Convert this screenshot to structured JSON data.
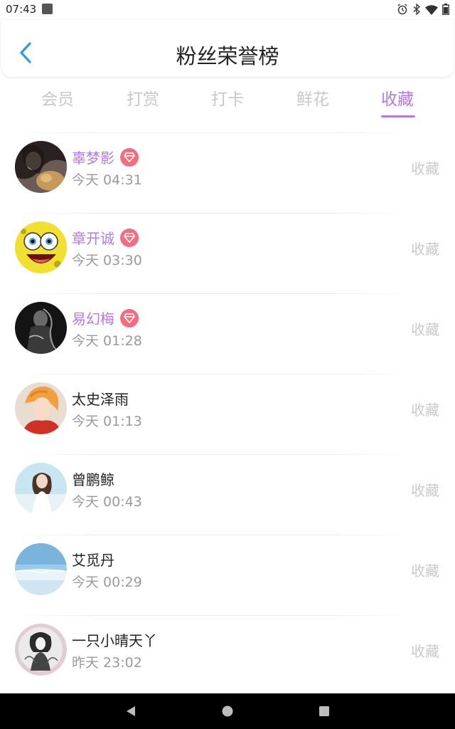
{
  "status_bar": {
    "time": "07:43",
    "icons": [
      "notification-app-icon",
      "alarm-icon",
      "bluetooth-icon",
      "wifi-icon",
      "battery-icon"
    ]
  },
  "header": {
    "title": "粉丝荣誉榜",
    "back_icon": "chevron-left-icon",
    "accent_color": "#2f9ae8"
  },
  "tabs": [
    {
      "label": "会员",
      "active": false
    },
    {
      "label": "打赏",
      "active": false
    },
    {
      "label": "打卡",
      "active": false
    },
    {
      "label": "鲜花",
      "active": false
    },
    {
      "label": "收藏",
      "active": true
    }
  ],
  "theme": {
    "active_color": "#b57ae0",
    "badge_color": "#f26d7d",
    "inactive_color": "#c8c8c8"
  },
  "fans": [
    {
      "name": "辜梦影",
      "time": "今天 04:31",
      "action": "收藏",
      "vip": true,
      "avatar": "avatar-dark-hair-with-cat"
    },
    {
      "name": "章开诚",
      "time": "今天 03:30",
      "action": "收藏",
      "vip": true,
      "avatar": "avatar-yellow-cartoon"
    },
    {
      "name": "易幻梅",
      "time": "今天 01:28",
      "action": "收藏",
      "vip": true,
      "avatar": "avatar-black-white-portrait"
    },
    {
      "name": "太史泽雨",
      "time": "今天 01:13",
      "action": "收藏",
      "vip": false,
      "avatar": "avatar-orange-hair-anime"
    },
    {
      "name": "曾鹏鲸",
      "time": "今天 00:43",
      "action": "收藏",
      "vip": false,
      "avatar": "avatar-beach-girl"
    },
    {
      "name": "艾觅丹",
      "time": "今天 00:29",
      "action": "收藏",
      "vip": false,
      "avatar": "avatar-blue-sky"
    },
    {
      "name": "一只小晴天丫",
      "time": "昨天 23:02",
      "action": "收藏",
      "vip": false,
      "avatar": "avatar-sketch-girl"
    }
  ],
  "nav_bar": {
    "buttons": [
      "back-triangle-icon",
      "home-circle-icon",
      "recents-square-icon"
    ]
  }
}
